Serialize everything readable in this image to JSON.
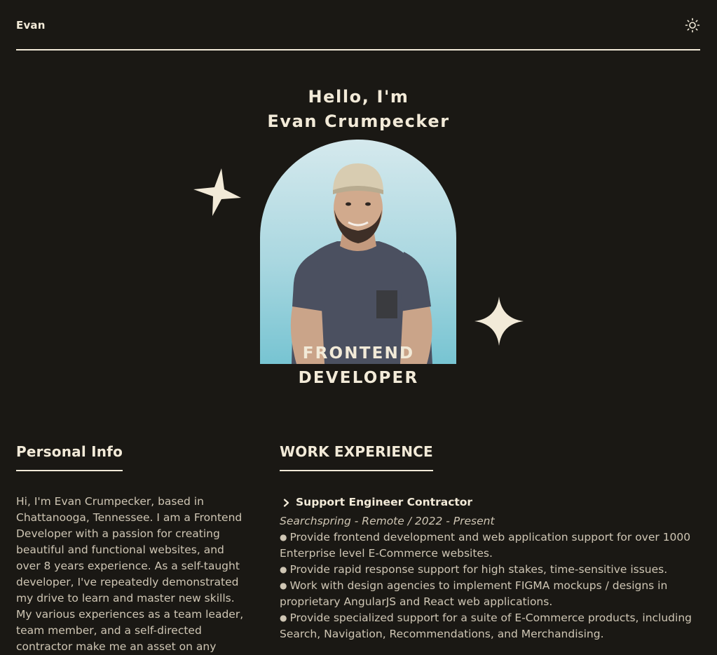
{
  "header": {
    "brand": "Evan",
    "theme_toggle_icon": "sun-icon"
  },
  "hero": {
    "greeting": "Hello, I'm",
    "name": "Evan Crumpecker",
    "role_line1": "FRONTEND",
    "role_line2": "DEVELOPER",
    "portrait_bg_color": "#a9d7e0",
    "star_color": "#f2ead8"
  },
  "personal_info": {
    "title": "Personal Info",
    "text": "Hi, I'm Evan Crumpecker, based in Chattanooga, Tennessee. I am a Frontend Developer with a passion for creating beautiful and functional websites, and over 8 years experience. As a self-taught developer, I've repeatedly demonstrated my drive to learn and master new skills. My various experiences as a team leader, team member, and a self-directed contractor make me an asset on any"
  },
  "work_experience": {
    "title": "WORK EXPERIENCE",
    "jobs": [
      {
        "role": "Support Engineer Contractor",
        "meta": "Searchspring - Remote / 2022 - Present",
        "bullets": [
          "Provide frontend development and web application support for over 1000 Enterprise level E-Commerce websites.",
          "Provide rapid response support for high stakes, time-sensitive issues.",
          "Work with design agencies to implement FIGMA mockups / designs in proprietary AngularJS and React web applications.",
          "Provide specialized support for a suite of E-Commerce products, including Search, Navigation, Recommendations, and Merchandising."
        ]
      }
    ]
  },
  "colors": {
    "background": "#1a1814",
    "foreground": "#f2ead8",
    "muted": "#cfc6b4"
  }
}
